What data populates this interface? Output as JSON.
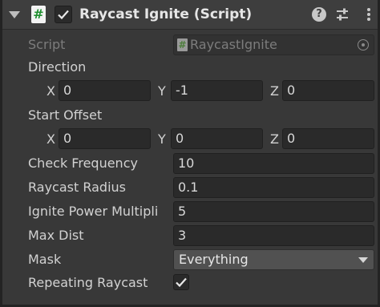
{
  "header": {
    "title": "Raycast Ignite (Script)",
    "script_icon_glyph": "#",
    "enabled": true,
    "icons": [
      "help-icon",
      "presets-icon",
      "kebab-menu-icon"
    ]
  },
  "script_field": {
    "label": "Script",
    "value": "RaycastIgnite",
    "icon_glyph": "#"
  },
  "direction": {
    "label": "Direction",
    "x_label": "X",
    "x": "0",
    "y_label": "Y",
    "y": "-1",
    "z_label": "Z",
    "z": "0"
  },
  "start_offset": {
    "label": "Start Offset",
    "x_label": "X",
    "x": "0",
    "y_label": "Y",
    "y": "0",
    "z_label": "Z",
    "z": "0"
  },
  "check_frequency": {
    "label": "Check Frequency",
    "value": "10"
  },
  "raycast_radius": {
    "label": "Raycast Radius",
    "value": "0.1"
  },
  "ignite_power_multiplier": {
    "label": "Ignite Power Multipli",
    "value": "5"
  },
  "max_dist": {
    "label": "Max Dist",
    "value": "3"
  },
  "mask": {
    "label": "Mask",
    "value": "Everything"
  },
  "repeating_raycast": {
    "label": "Repeating Raycast",
    "checked": true
  },
  "colors": {
    "panel_bg": "#383838",
    "header_bg": "#3e3e3e",
    "field_bg": "#2a2a2a",
    "dropdown_bg": "#515151",
    "text": "#d2d2d2",
    "script_icon_green": "#1f8f2f"
  }
}
